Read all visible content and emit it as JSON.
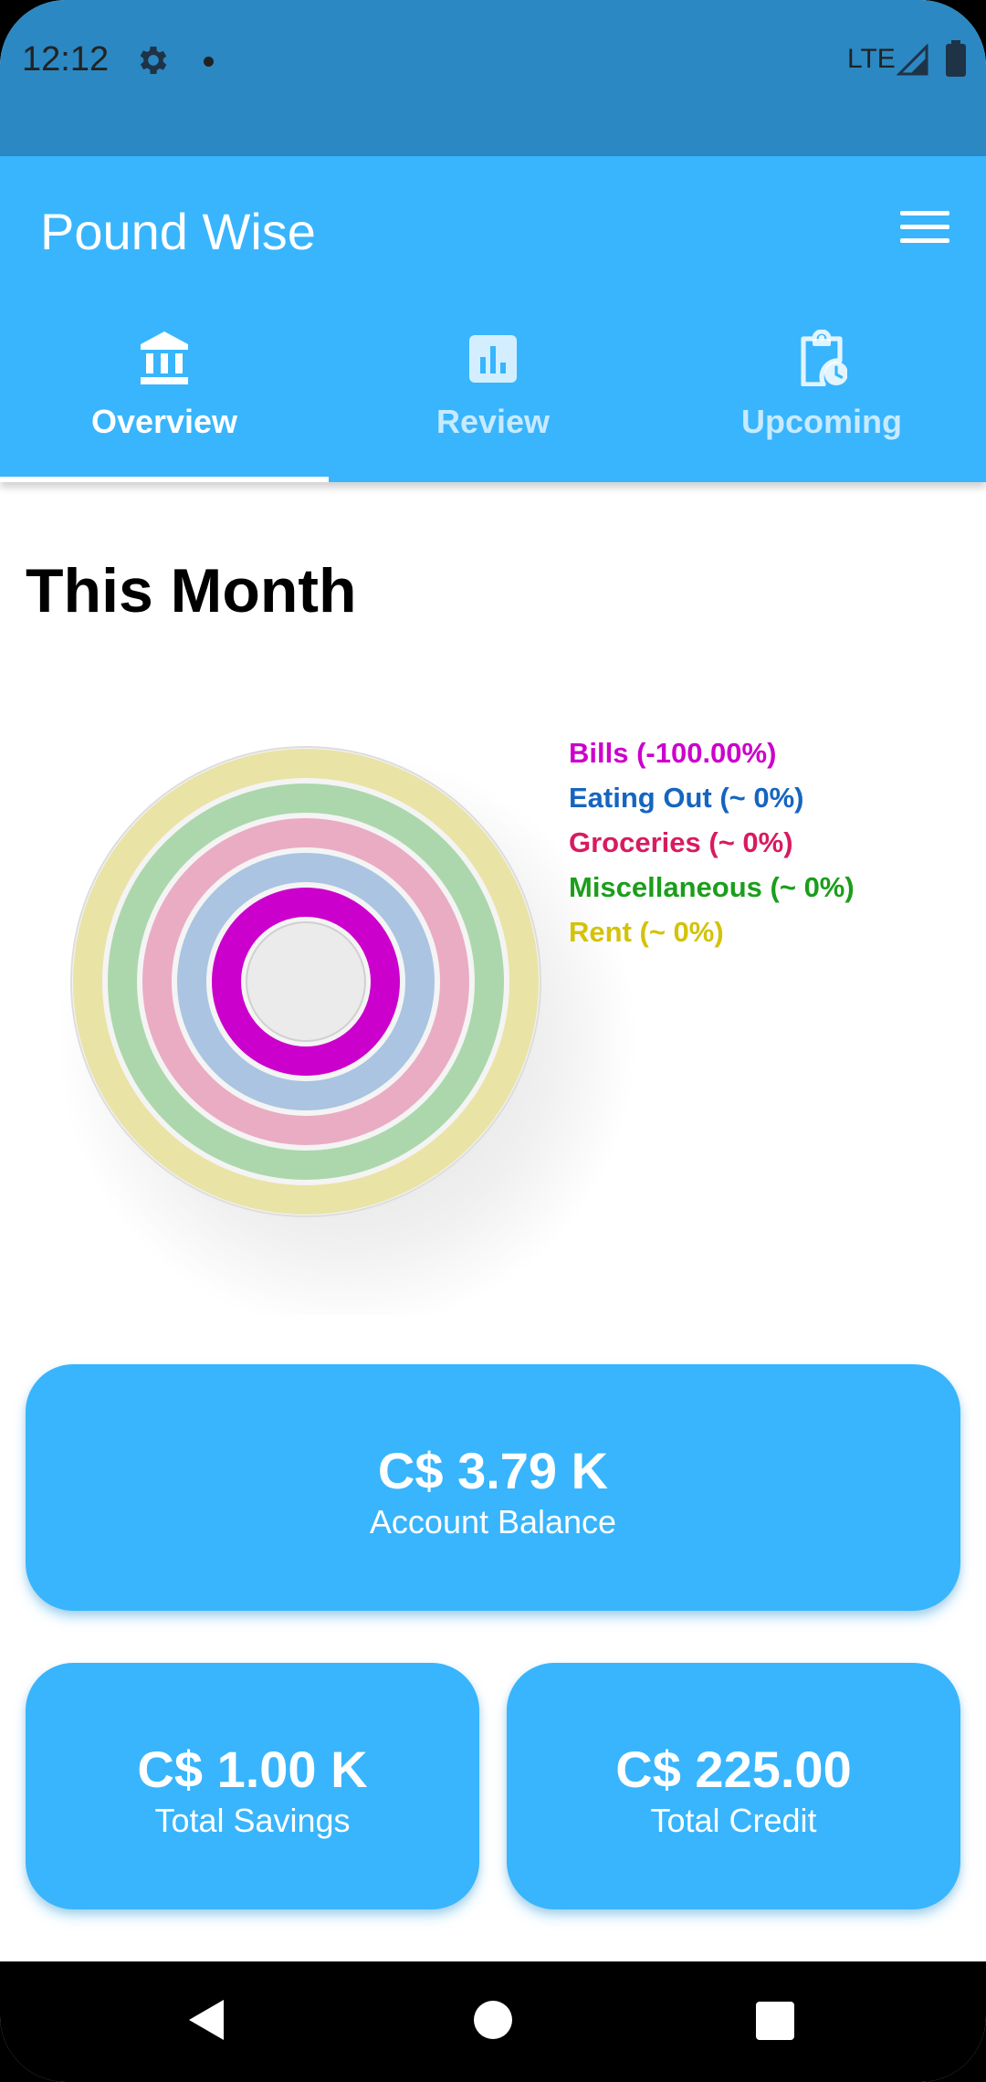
{
  "status_bar": {
    "time": "12:12",
    "network": "LTE"
  },
  "app_bar": {
    "title": "Pound Wise"
  },
  "tabs": [
    {
      "label": "Overview",
      "icon": "bank-icon",
      "active": true
    },
    {
      "label": "Review",
      "icon": "bar-chart-icon",
      "active": false
    },
    {
      "label": "Upcoming",
      "icon": "clipboard-clock-icon",
      "active": false
    }
  ],
  "main": {
    "heading": "This Month"
  },
  "chart_data": {
    "type": "pie",
    "legend_position": "top-right",
    "series": [
      {
        "name": "Bills (-100.00%)",
        "color": "#cc00cc"
      },
      {
        "name": "Eating Out (~ 0%)",
        "color": "#1565c0"
      },
      {
        "name": "Groceries (~ 0%)",
        "color": "#d81b60"
      },
      {
        "name": "Miscellaneous (~ 0%)",
        "color": "#1b9e1b"
      },
      {
        "name": "Rent (~ 0%)",
        "color": "#d4c20a"
      }
    ]
  },
  "cards": {
    "balance": {
      "amount": "C$ 3.79 K",
      "label": "Account Balance"
    },
    "savings": {
      "amount": "C$ 1.00 K",
      "label": "Total Savings"
    },
    "credit": {
      "amount": "C$ 225.00",
      "label": "Total Credit"
    }
  },
  "colors": {
    "primary": "#38b5fd",
    "status_bar": "#2b88c2"
  }
}
